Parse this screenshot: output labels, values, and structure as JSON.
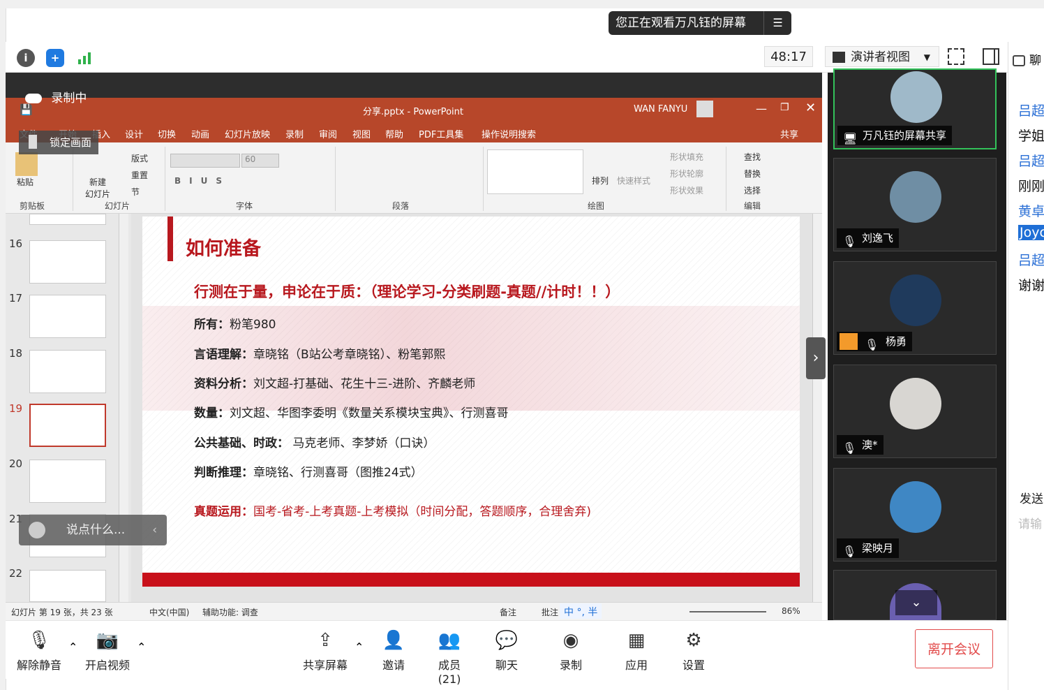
{
  "banner": {
    "text": "您正在观看万凡钰的屏幕",
    "menu_icon": "☰"
  },
  "topbar": {
    "timer": "48:17",
    "view_mode": "演讲者视图"
  },
  "recording": {
    "label": "录制中",
    "lock_label": "锁定画面"
  },
  "ppt": {
    "title": "分享.pptx  -  PowerPoint",
    "user": "WAN FANYU",
    "share": "共享",
    "tabs": [
      "文件",
      "开始",
      "插入",
      "设计",
      "切换",
      "动画",
      "幻灯片放映",
      "录制",
      "审阅",
      "视图",
      "帮助",
      "PDF工具集",
      "操作说明搜索"
    ],
    "ribbon": {
      "paste": "粘贴",
      "clipboard": "剪贴板",
      "new_slide": "新建\n幻灯片",
      "layout": "版式",
      "reset": "重置",
      "section": "节",
      "slides": "幻灯片",
      "font_size": "60",
      "font": "字体",
      "paragraph": "段落",
      "arrange": "排列",
      "quick_style": "快速样式",
      "shape_fill": "形状填充",
      "shape_outline": "形状轮廓",
      "shape_effect": "形状效果",
      "drawing": "绘图",
      "find": "查找",
      "replace": "替换",
      "select": "选择",
      "editing": "编辑"
    },
    "thumb_numbers": [
      "16",
      "17",
      "18",
      "19",
      "20",
      "21",
      "22"
    ],
    "slide": {
      "title": "如何准备",
      "subtitle": "行测在于量，申论在于质：（理论学习-分类刷题-真题//计时！！）",
      "lines": [
        {
          "label": "所有：",
          "text": "粉笔980"
        },
        {
          "label": "言语理解：",
          "text": "章晓铭（B站公考章晓铭）、粉笔郭熙"
        },
        {
          "label": "资料分析：",
          "text": "刘文超-打基础、花生十三-进阶、齐麟老师"
        },
        {
          "label": "数量：",
          "text": "刘文超、华图李委明《数量关系模块宝典》、行测喜哥"
        },
        {
          "label": "公共基础、时政：",
          "text": " 马克老师、李梦娇（口诀）"
        },
        {
          "label": "判断推理：",
          "text": "章晓铭、行测喜哥（图推24式）"
        }
      ],
      "footer_label": "真题运用：",
      "footer_text": "国考-省考-上考真题-上考模拟（时间分配，答题顺序，合理舍弃)"
    },
    "status": {
      "slide_info": "幻灯片 第 19 张，共 23 张",
      "language": "中文(中国)",
      "accessibility": "辅助功能: 调查",
      "notes": "备注",
      "comments": "批注",
      "ime": "中 °, 半",
      "zoom": "86%"
    }
  },
  "say_placeholder": "说点什么...",
  "participants": [
    {
      "name": "万凡钰的屏幕共享",
      "active": true,
      "avatar_color": "#9fb9c9"
    },
    {
      "name": "刘逸飞",
      "active": false,
      "avatar_color": "#6f8ea4"
    },
    {
      "name": "杨勇",
      "active": false,
      "avatar_color": "#1f3a5c"
    },
    {
      "name": "澳*",
      "active": false,
      "avatar_color": "#d8d6d2"
    },
    {
      "name": "梁映月",
      "active": false,
      "avatar_color": "#3f87c4"
    }
  ],
  "chat": {
    "header": "聊",
    "messages": [
      {
        "text": "吕超",
        "color": "#2a6fd6"
      },
      {
        "text": "学姐",
        "color": "#111111"
      },
      {
        "text": "吕超",
        "color": "#2a6fd6"
      },
      {
        "text": "刚刚",
        "color": "#111111"
      },
      {
        "text": "黄卓",
        "color": "#2a6fd6"
      },
      {
        "text": "Joyc",
        "color": "#ffffff"
      },
      {
        "text": "吕超",
        "color": "#2a6fd6"
      },
      {
        "text": "谢谢",
        "color": "#111111"
      }
    ],
    "send": "发送",
    "input_placeholder": "请输"
  },
  "bottom": {
    "unmute": "解除静音",
    "video": "开启视频",
    "share": "共享屏幕",
    "invite": "邀请",
    "members": "成员(21)",
    "chat": "聊天",
    "record": "录制",
    "apps": "应用",
    "settings": "设置",
    "leave": "离开会议"
  }
}
